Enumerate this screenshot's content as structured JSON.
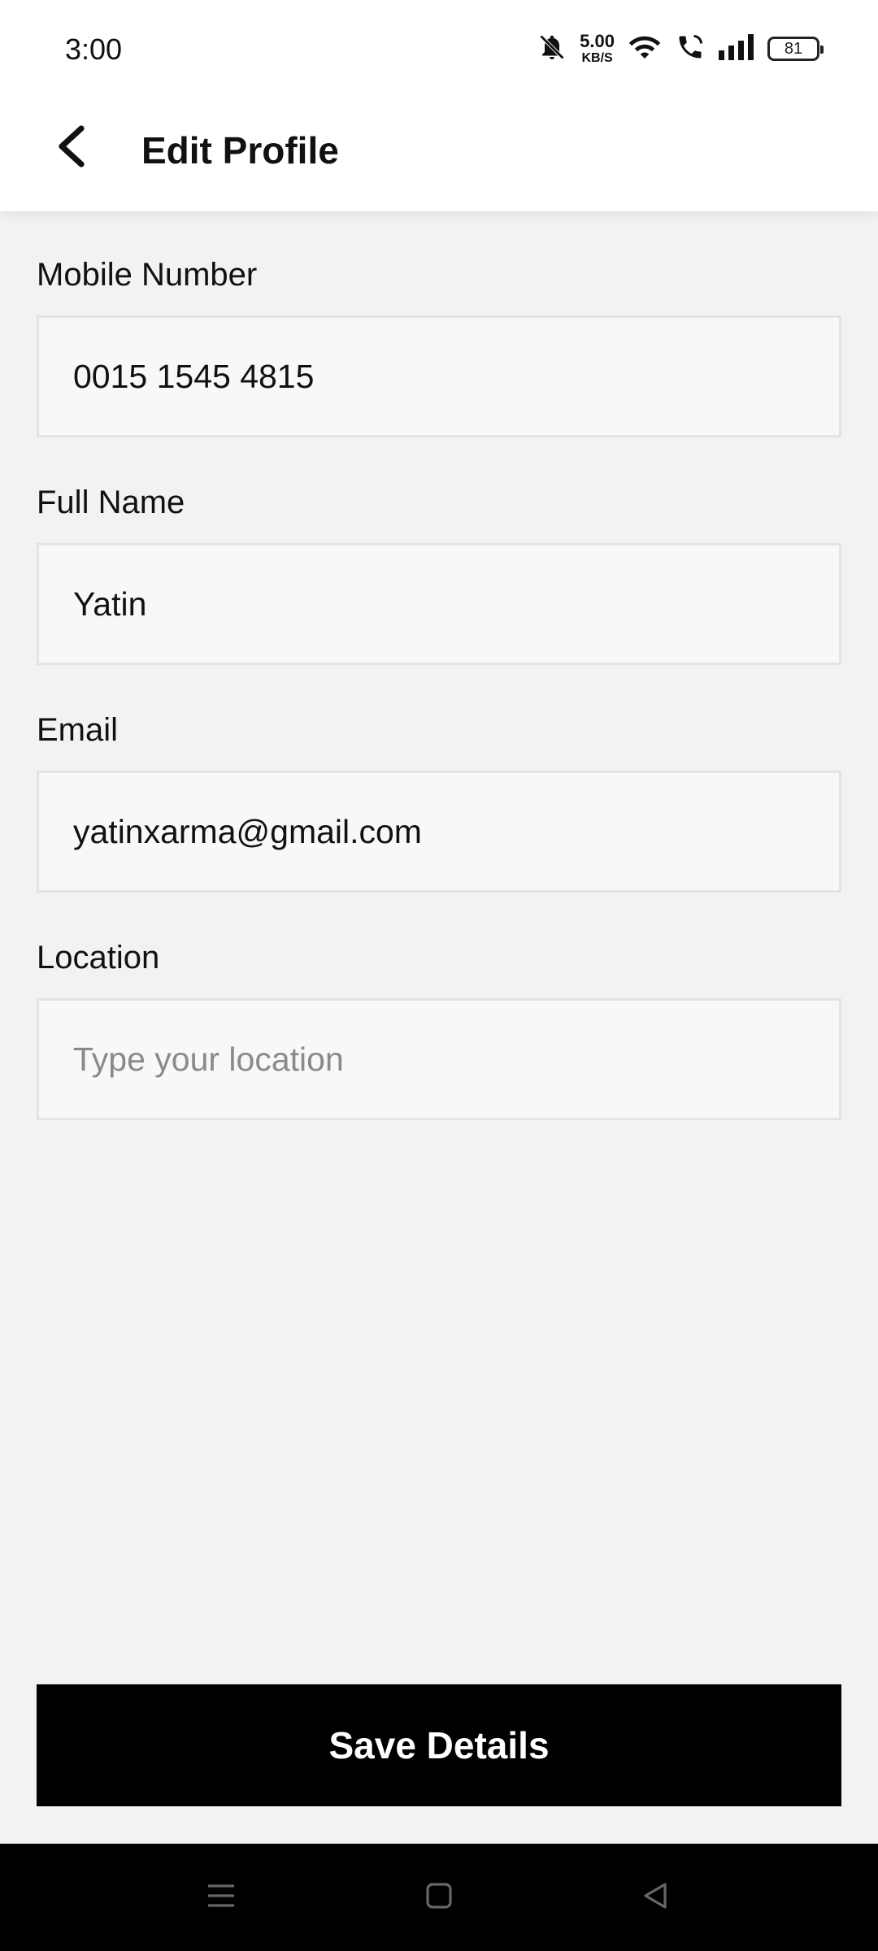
{
  "status_bar": {
    "time": "3:00",
    "net_speed_value": "5.00",
    "net_speed_unit": "KB/S",
    "battery": "81",
    "icons": [
      "bell-muted-icon",
      "wifi-icon",
      "wifi-call-icon",
      "signal-icon",
      "battery-icon"
    ]
  },
  "header": {
    "title": "Edit Profile",
    "back_icon": "chevron-left-icon"
  },
  "form": {
    "mobile": {
      "label": "Mobile Number",
      "value": "0015 1545 4815",
      "placeholder": ""
    },
    "name": {
      "label": "Full Name",
      "value": "Yatin",
      "placeholder": ""
    },
    "email": {
      "label": "Email",
      "value": "yatinxarma@gmail.com",
      "placeholder": ""
    },
    "location": {
      "label": "Location",
      "value": "",
      "placeholder": "Type your location"
    }
  },
  "actions": {
    "save_label": "Save Details"
  },
  "nav": {
    "icons": [
      "menu-icon",
      "home-icon",
      "back-triangle-icon"
    ]
  },
  "colors": {
    "background": "#f2f2f2",
    "field_bg": "#f8f8f8",
    "button_bg": "#000000",
    "button_text": "#ffffff"
  }
}
